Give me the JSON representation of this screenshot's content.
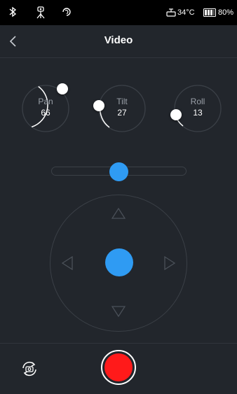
{
  "status_bar": {
    "icons": [
      "bluetooth-icon",
      "tripod-icon",
      "sync-icon",
      "gimbal-icon",
      "battery-icon"
    ],
    "temperature": "34°C",
    "battery": "80%"
  },
  "header": {
    "back_icon": "chevron-left-icon",
    "title": "Video"
  },
  "dials": [
    {
      "name": "pan",
      "label": "Pan",
      "value": "66"
    },
    {
      "name": "tilt",
      "label": "Tilt",
      "value": "27"
    },
    {
      "name": "roll",
      "label": "Roll",
      "value": "13"
    }
  ],
  "slider": {
    "position_fraction": 0.5
  },
  "joystick": {
    "arrows": [
      "arrow-up-icon",
      "arrow-down-icon",
      "arrow-left-icon",
      "arrow-right-icon"
    ]
  },
  "bottom": {
    "switch_icon": "switch-camera-icon",
    "record_icon": "record-icon"
  },
  "colors": {
    "background": "#22262c",
    "accent": "#2f9bf3",
    "record": "#ff1a1a"
  }
}
